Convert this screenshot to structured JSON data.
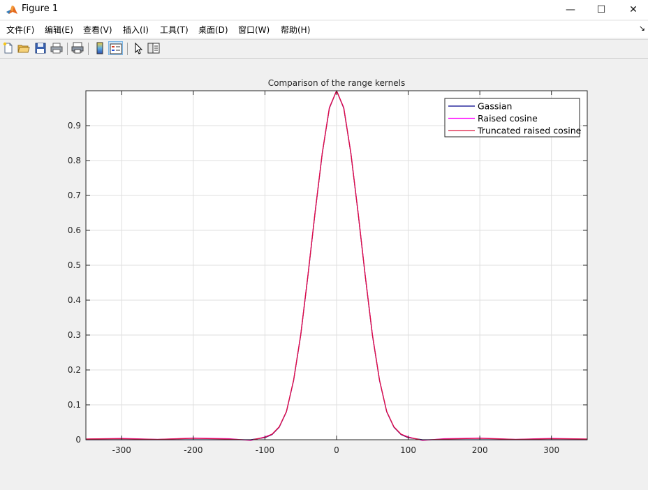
{
  "window": {
    "title": "Figure 1",
    "minimize_glyph": "—",
    "maximize_glyph": "☐",
    "close_glyph": "✕",
    "app_icon": "matlab-logo-icon"
  },
  "menu": {
    "items": [
      "文件(F)",
      "编辑(E)",
      "查看(V)",
      "插入(I)",
      "工具(T)",
      "桌面(D)",
      "窗口(W)",
      "帮助(H)"
    ],
    "overflow_glyph": "↘"
  },
  "toolbar": {
    "icons": [
      "new-figure-icon",
      "open-file-icon",
      "save-icon",
      "print-icon",
      "print-preview-icon",
      "colorbar-icon",
      "legend-icon",
      "pointer-icon",
      "property-editor-icon"
    ]
  },
  "chart_data": {
    "type": "line",
    "title": "Comparison of the range kernels",
    "xlabel": "",
    "ylabel": "",
    "xlim": [
      -350,
      350
    ],
    "ylim": [
      0,
      1
    ],
    "xticks": [
      -300,
      -200,
      -100,
      0,
      100,
      200,
      300
    ],
    "xtick_labels": [
      "-300",
      "-200",
      "-100",
      "0",
      "100",
      "200",
      "300"
    ],
    "yticks": [
      0,
      0.1,
      0.2,
      0.3,
      0.4,
      0.5,
      0.6,
      0.7,
      0.8,
      0.9
    ],
    "ytick_labels": [
      "0",
      "0.1",
      "0.2",
      "0.3",
      "0.4",
      "0.5",
      "0.6",
      "0.7",
      "0.8",
      "0.9"
    ],
    "grid": true,
    "legend_position": "top-right",
    "x": [
      -350,
      -300,
      -250,
      -200,
      -150,
      -120,
      -100,
      -90,
      -80,
      -70,
      -60,
      -50,
      -40,
      -30,
      -20,
      -10,
      0,
      10,
      20,
      30,
      40,
      50,
      60,
      70,
      80,
      90,
      100,
      120,
      150,
      200,
      250,
      300,
      350
    ],
    "series": [
      {
        "name": "Gassian",
        "color": "#00008b",
        "values": [
          0,
          0,
          0,
          0,
          0,
          0,
          0.006,
          0.015,
          0.036,
          0.08,
          0.17,
          0.3,
          0.47,
          0.65,
          0.82,
          0.95,
          1.0,
          0.95,
          0.82,
          0.65,
          0.47,
          0.3,
          0.17,
          0.08,
          0.036,
          0.015,
          0.006,
          0,
          0,
          0,
          0,
          0,
          0
        ]
      },
      {
        "name": "Raised cosine",
        "color": "#ff00ff",
        "values": [
          0.002,
          0.004,
          0.001,
          0.005,
          0.003,
          -0.002,
          0.008,
          0.016,
          0.037,
          0.081,
          0.171,
          0.302,
          0.472,
          0.652,
          0.822,
          0.952,
          1.0,
          0.952,
          0.822,
          0.652,
          0.472,
          0.302,
          0.171,
          0.081,
          0.037,
          0.016,
          0.008,
          -0.002,
          0.003,
          0.005,
          0.001,
          0.004,
          0.002
        ]
      },
      {
        "name": "Truncated raised cosine",
        "color": "#dc143c",
        "values": [
          0.002,
          0.003,
          0.001,
          0.004,
          0.002,
          -0.001,
          0.007,
          0.016,
          0.037,
          0.081,
          0.171,
          0.301,
          0.471,
          0.651,
          0.821,
          0.951,
          1.0,
          0.951,
          0.821,
          0.651,
          0.471,
          0.301,
          0.171,
          0.081,
          0.037,
          0.016,
          0.007,
          -0.001,
          0.002,
          0.004,
          0.001,
          0.003,
          0.002
        ]
      }
    ]
  }
}
